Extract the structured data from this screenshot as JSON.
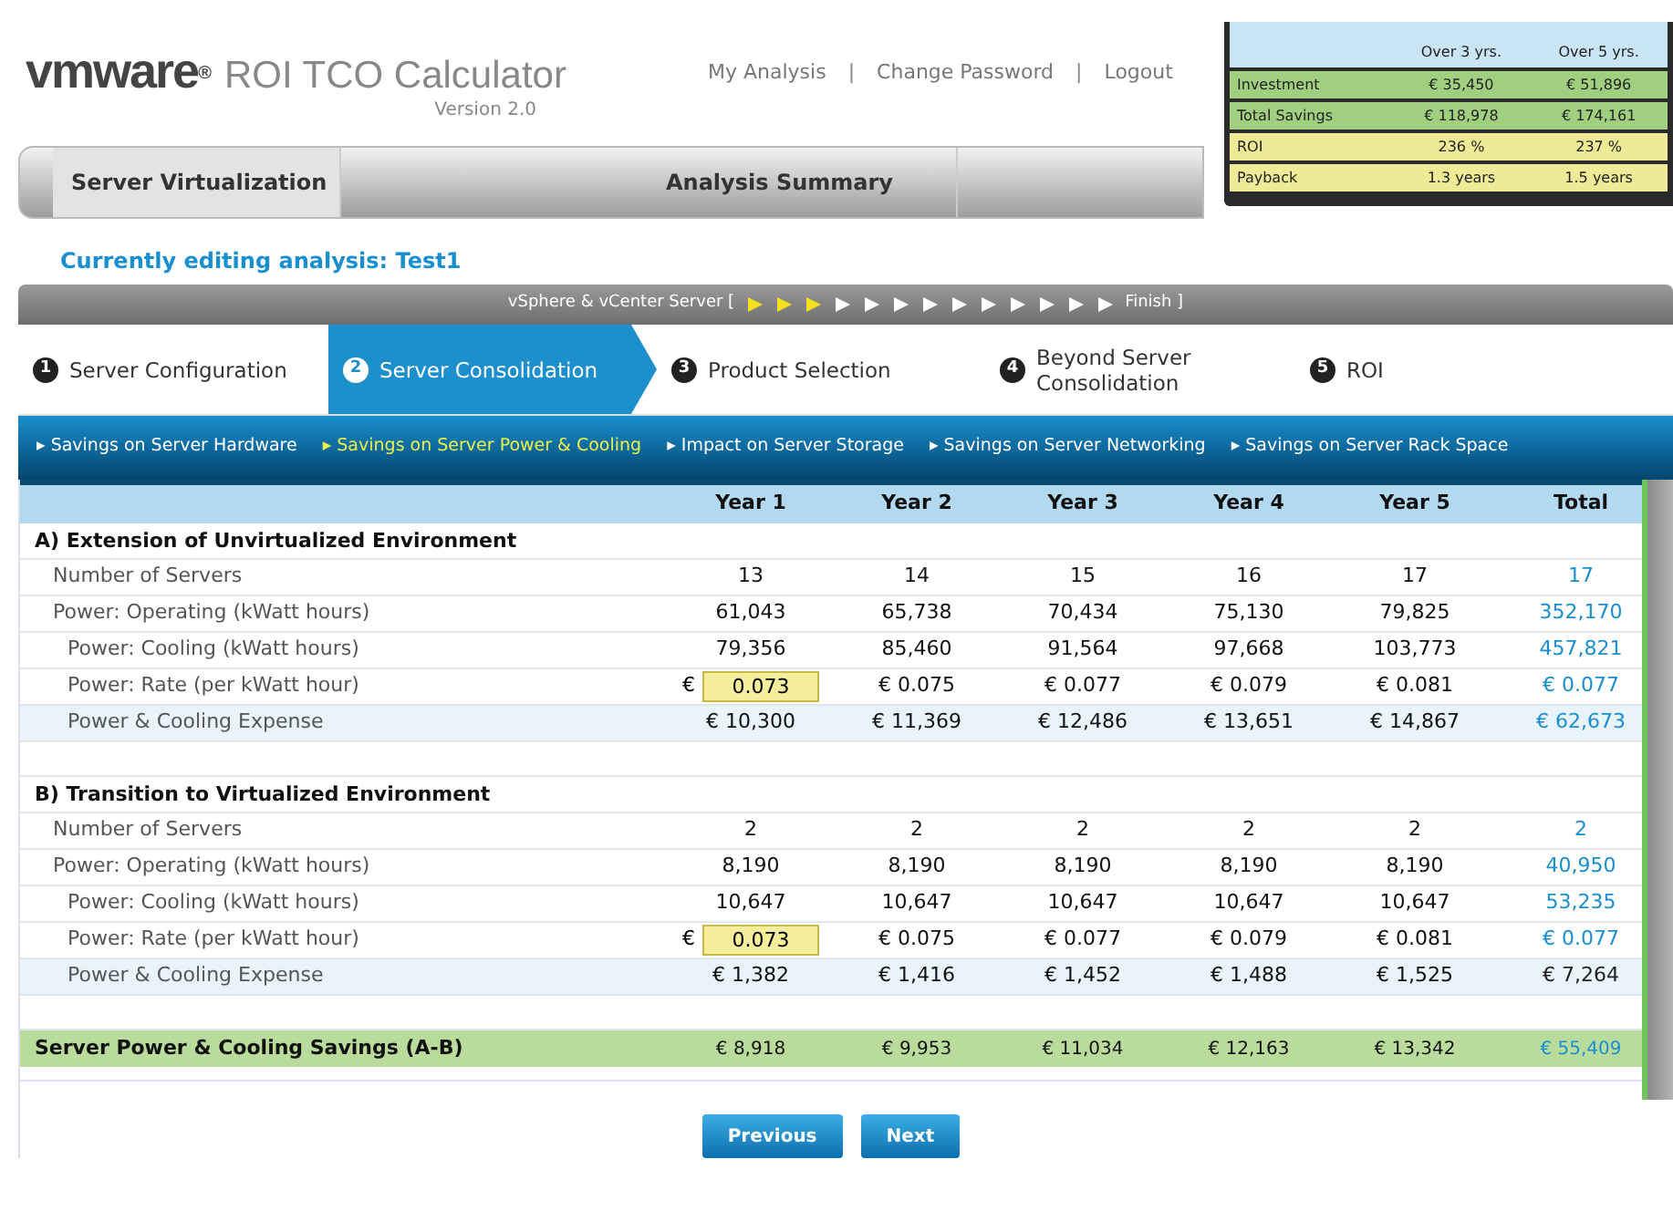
{
  "header": {
    "brand": "vmware",
    "brand_mark": "®",
    "app_title": "ROI TCO Calculator",
    "version": "Version 2.0",
    "links": [
      "My Analysis",
      "Change Password",
      "Logout"
    ],
    "separator": "|"
  },
  "summary": {
    "columns": [
      "Over 3 yrs.",
      "Over 5 yrs."
    ],
    "rows": [
      {
        "label": "Investment",
        "values": [
          "€ 35,450",
          "€ 51,896"
        ],
        "color": "#9fcf7f"
      },
      {
        "label": "Total Savings",
        "values": [
          "€ 118,978",
          "€ 174,161"
        ],
        "color": "#9fcf7f"
      },
      {
        "label": "ROI",
        "values": [
          "236 %",
          "237 %"
        ],
        "color": "#eeea96"
      },
      {
        "label": "Payback",
        "values": [
          "1.3 years",
          "1.5 years"
        ],
        "color": "#eeea96"
      }
    ]
  },
  "main_tabs": [
    {
      "label": "Server Virtualization",
      "selected": true
    },
    {
      "label": "Analysis Summary",
      "selected": false
    }
  ],
  "editing": {
    "label": "Currently editing analysis:",
    "name": "Test1"
  },
  "progress": {
    "start": "vSphere & vCenter Server [",
    "end": "Finish ]",
    "steps": [
      {
        "done": true
      },
      {
        "done": true
      },
      {
        "done": true
      },
      {
        "done": false
      },
      {
        "done": false
      },
      {
        "done": false
      },
      {
        "done": false
      },
      {
        "done": false
      },
      {
        "done": false
      },
      {
        "done": false
      },
      {
        "done": false
      },
      {
        "done": false
      },
      {
        "done": false
      }
    ]
  },
  "steps": [
    {
      "number": "1",
      "label": "Server Configuration",
      "selected": false
    },
    {
      "number": "2",
      "label": "Server Consolidation",
      "selected": true
    },
    {
      "number": "3",
      "label": "Product Selection",
      "selected": false
    },
    {
      "number": "4",
      "label": "Beyond Server Consolidation",
      "selected": false
    },
    {
      "number": "5",
      "label": "ROI",
      "selected": false
    }
  ],
  "subnav": [
    {
      "bullet": "▸",
      "label": "Savings on Server Hardware",
      "selected": false
    },
    {
      "bullet": "▸",
      "label": "Savings on Server Power & Cooling",
      "selected": true
    },
    {
      "bullet": "▸",
      "label": "Impact on Server Storage",
      "selected": false
    },
    {
      "bullet": "▸",
      "label": "Savings on Server Networking",
      "selected": false
    },
    {
      "bullet": "▸",
      "label": "Savings on Server Rack Space",
      "selected": false
    }
  ],
  "table": {
    "columns": [
      "Year 1",
      "Year 2",
      "Year 3",
      "Year 4",
      "Year 5",
      "Total"
    ],
    "rows": [
      {
        "kind": "section",
        "label": "A) Extension of Unvirtualized Environment"
      },
      {
        "kind": "metric",
        "label": "Number of Servers",
        "cells": [
          "13",
          "14",
          "15",
          "16",
          "17"
        ],
        "total": "17",
        "total_emphasis": true
      },
      {
        "kind": "metric",
        "label": "Power: Operating (kWatt hours)",
        "cells": [
          "61,043",
          "65,738",
          "70,434",
          "75,130",
          "79,825"
        ],
        "total": "352,170",
        "total_emphasis": true
      },
      {
        "kind": "submetric",
        "label": "Power: Cooling (kWatt hours)",
        "cells": [
          "79,356",
          "85,460",
          "91,564",
          "97,668",
          "103,773"
        ],
        "total": "457,821",
        "total_emphasis": true
      },
      {
        "kind": "input",
        "label": "Power: Rate (per kWatt hour)",
        "currency": "€",
        "input": "0.073",
        "cells": [
          "€ 0.075",
          "€ 0.077",
          "€ 0.079",
          "€ 0.081"
        ],
        "total": "€ 0.077",
        "total_emphasis": true
      },
      {
        "kind": "expense",
        "label": "Power & Cooling Expense",
        "cells": [
          "€ 10,300",
          "€ 11,369",
          "€ 12,486",
          "€ 13,651",
          "€ 14,867"
        ],
        "total": "€ 62,673",
        "total_emphasis": true
      },
      {
        "kind": "spacer"
      },
      {
        "kind": "section",
        "label": "B) Transition to Virtualized Environment"
      },
      {
        "kind": "metric",
        "label": "Number of Servers",
        "cells": [
          "2",
          "2",
          "2",
          "2",
          "2"
        ],
        "total": "2",
        "total_emphasis": true
      },
      {
        "kind": "metric",
        "label": "Power: Operating (kWatt hours)",
        "cells": [
          "8,190",
          "8,190",
          "8,190",
          "8,190",
          "8,190"
        ],
        "total": "40,950",
        "total_emphasis": true
      },
      {
        "kind": "submetric",
        "label": "Power: Cooling (kWatt hours)",
        "cells": [
          "10,647",
          "10,647",
          "10,647",
          "10,647",
          "10,647"
        ],
        "total": "53,235",
        "total_emphasis": true
      },
      {
        "kind": "input",
        "label": "Power: Rate (per kWatt hour)",
        "currency": "€",
        "input": "0.073",
        "cells": [
          "€ 0.075",
          "€ 0.077",
          "€ 0.079",
          "€ 0.081"
        ],
        "total": "€ 0.077",
        "total_emphasis": true
      },
      {
        "kind": "expense",
        "label": "Power & Cooling Expense",
        "cells": [
          "€ 1,382",
          "€ 1,416",
          "€ 1,452",
          "€ 1,488",
          "€ 1,525"
        ],
        "total": "€ 7,264",
        "total_emphasis": false
      },
      {
        "kind": "spacer"
      },
      {
        "kind": "savings",
        "label": "Server Power & Cooling Savings (A-B)",
        "cells": [
          "€ 8,918",
          "€ 9,953",
          "€ 11,034",
          "€ 12,163",
          "€ 13,342"
        ],
        "total": "€ 55,409",
        "total_emphasis": true
      }
    ]
  },
  "buttons": [
    "Previous",
    "Next"
  ]
}
